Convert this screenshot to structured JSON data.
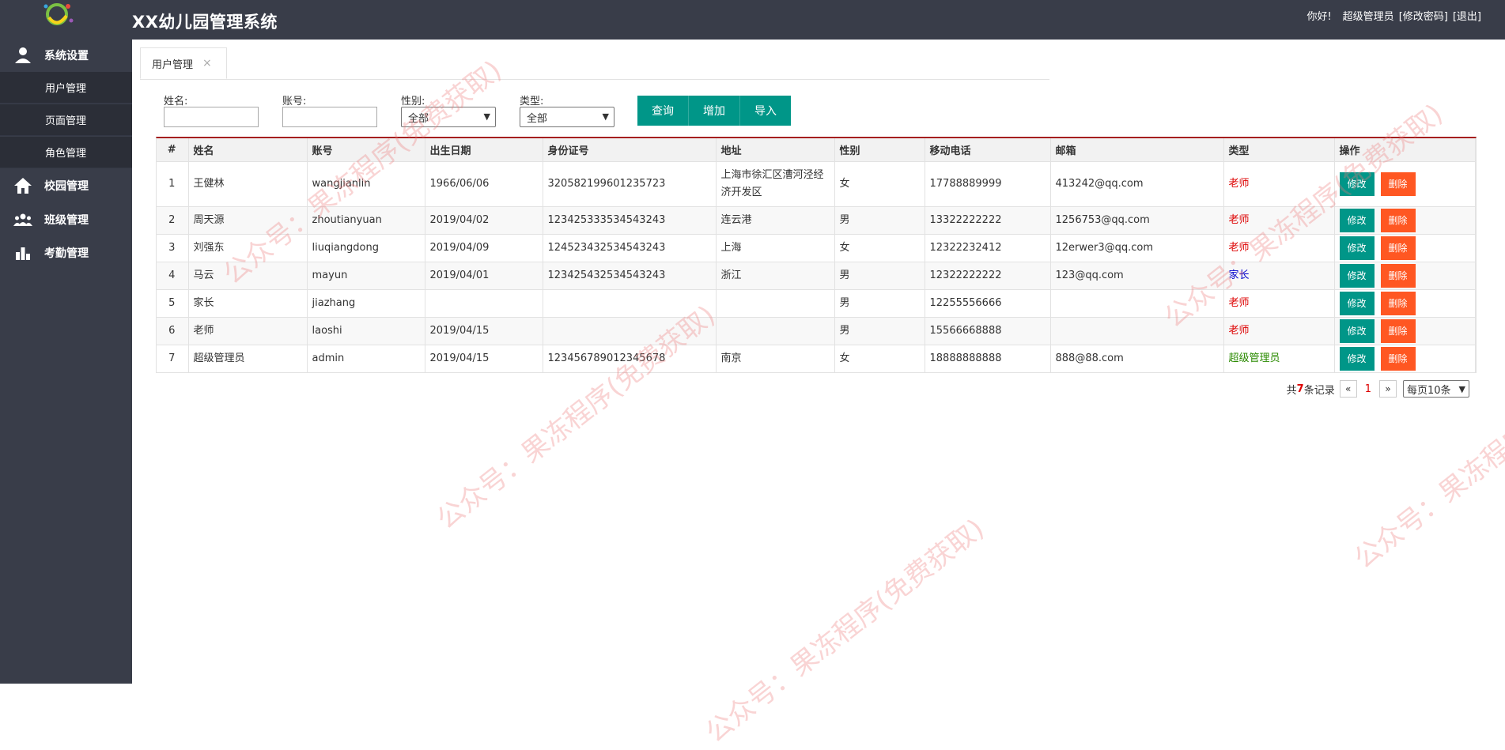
{
  "app": {
    "title": "XX幼儿园管理系统"
  },
  "header": {
    "greeting": "你好!",
    "user": "超级管理员",
    "change_password": "[修改密码]",
    "logout": "[退出]"
  },
  "sidebar": {
    "groups": [
      {
        "label": "系统设置",
        "icon": "user-icon"
      },
      {
        "label": "校园管理",
        "icon": "home-icon"
      },
      {
        "label": "班级管理",
        "icon": "group-icon"
      },
      {
        "label": "考勤管理",
        "icon": "bar-chart-icon"
      }
    ],
    "sub_items": [
      "用户管理",
      "页面管理",
      "角色管理"
    ]
  },
  "tabs": [
    {
      "label": "用户管理",
      "close": "×"
    }
  ],
  "filters": {
    "name_label": "姓名:",
    "account_label": "账号:",
    "gender_label": "性别:",
    "gender_value": "全部",
    "type_label": "类型:",
    "type_value": "全部",
    "buttons": [
      "查询",
      "增加",
      "导入"
    ]
  },
  "table": {
    "headers": [
      "#",
      "姓名",
      "账号",
      "出生日期",
      "身份证号",
      "地址",
      "性别",
      "移动电话",
      "邮箱",
      "类型",
      "操作"
    ],
    "edit_label": "修改",
    "delete_label": "删除",
    "rows": [
      {
        "no": "1",
        "name": "王健林",
        "account": "wangjianlin",
        "birth": "1966/06/06",
        "id": "320582199601235723",
        "address": "上海市徐汇区漕河泾经济开发区",
        "gender": "女",
        "phone": "17788889999",
        "email": "413242@qq.com",
        "type": "老师"
      },
      {
        "no": "2",
        "name": "周天源",
        "account": "zhoutianyuan",
        "birth": "2019/04/02",
        "id": "123425333534543243",
        "address": "连云港",
        "gender": "男",
        "phone": "13322222222",
        "email": "1256753@qq.com",
        "type": "老师"
      },
      {
        "no": "3",
        "name": "刘强东",
        "account": "liuqiangdong",
        "birth": "2019/04/09",
        "id": "124523432534543243",
        "address": "上海",
        "gender": "女",
        "phone": "12322232412",
        "email": "12erwer3@qq.com",
        "type": "老师"
      },
      {
        "no": "4",
        "name": "马云",
        "account": "mayun",
        "birth": "2019/04/01",
        "id": "123425432534543243",
        "address": "浙江",
        "gender": "男",
        "phone": "12322222222",
        "email": "123@qq.com",
        "type": "家长"
      },
      {
        "no": "5",
        "name": "家长",
        "account": "jiazhang",
        "birth": "",
        "id": "",
        "address": "",
        "gender": "男",
        "phone": "12255556666",
        "email": "",
        "type": "老师"
      },
      {
        "no": "6",
        "name": "老师",
        "account": "laoshi",
        "birth": "2019/04/15",
        "id": "",
        "address": "",
        "gender": "男",
        "phone": "15566668888",
        "email": "",
        "type": "老师"
      },
      {
        "no": "7",
        "name": "超级管理员",
        "account": "admin",
        "birth": "2019/04/15",
        "id": "123456789012345678",
        "address": "南京",
        "gender": "女",
        "phone": "18888888888",
        "email": "888@88.com",
        "type": "超级管理员"
      }
    ]
  },
  "pager": {
    "total_prefix": "共",
    "total": "7",
    "total_suffix": "条记录",
    "prev": "«",
    "current": "1",
    "next": "»",
    "page_size": "每页10条"
  },
  "watermark": "公众号：果冻程序(免费获取)",
  "colors": {
    "sidebar": "#393D49",
    "primary": "#009688",
    "danger": "#FF5722",
    "header_rule": "#a51e1e"
  }
}
